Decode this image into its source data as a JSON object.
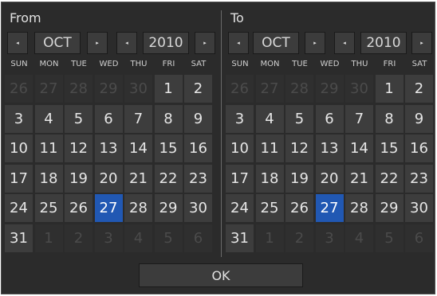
{
  "from": {
    "title": "From",
    "month": "OCT",
    "year": "2010",
    "selected_day": 27
  },
  "to": {
    "title": "To",
    "month": "OCT",
    "year": "2010",
    "selected_day": 27
  },
  "weekdays": [
    "SUN",
    "MON",
    "TUE",
    "WED",
    "THU",
    "FRI",
    "SAT"
  ],
  "grid": [
    [
      {
        "d": "26",
        "o": true
      },
      {
        "d": "27",
        "o": true
      },
      {
        "d": "28",
        "o": true
      },
      {
        "d": "29",
        "o": true
      },
      {
        "d": "30",
        "o": true
      },
      {
        "d": "1"
      },
      {
        "d": "2"
      }
    ],
    [
      {
        "d": "3"
      },
      {
        "d": "4"
      },
      {
        "d": "5"
      },
      {
        "d": "6"
      },
      {
        "d": "7"
      },
      {
        "d": "8"
      },
      {
        "d": "9"
      }
    ],
    [
      {
        "d": "10"
      },
      {
        "d": "11"
      },
      {
        "d": "12"
      },
      {
        "d": "13"
      },
      {
        "d": "14"
      },
      {
        "d": "15"
      },
      {
        "d": "16"
      }
    ],
    [
      {
        "d": "17"
      },
      {
        "d": "18"
      },
      {
        "d": "19"
      },
      {
        "d": "20"
      },
      {
        "d": "21"
      },
      {
        "d": "22"
      },
      {
        "d": "23"
      }
    ],
    [
      {
        "d": "24"
      },
      {
        "d": "25"
      },
      {
        "d": "26"
      },
      {
        "d": "27"
      },
      {
        "d": "28"
      },
      {
        "d": "29"
      },
      {
        "d": "30"
      }
    ],
    [
      {
        "d": "31"
      },
      {
        "d": "1",
        "o": true
      },
      {
        "d": "2",
        "o": true
      },
      {
        "d": "3",
        "o": true
      },
      {
        "d": "4",
        "o": true
      },
      {
        "d": "5",
        "o": true
      },
      {
        "d": "6",
        "o": true
      }
    ]
  ],
  "icons": {
    "prev": "◂",
    "next": "▸"
  },
  "ok_label": "OK",
  "colors": {
    "background": "#2b2b2b",
    "day_cell": "#3d3d3d",
    "selected": "#2158b3",
    "other_month_text": "#4b4b4b"
  }
}
